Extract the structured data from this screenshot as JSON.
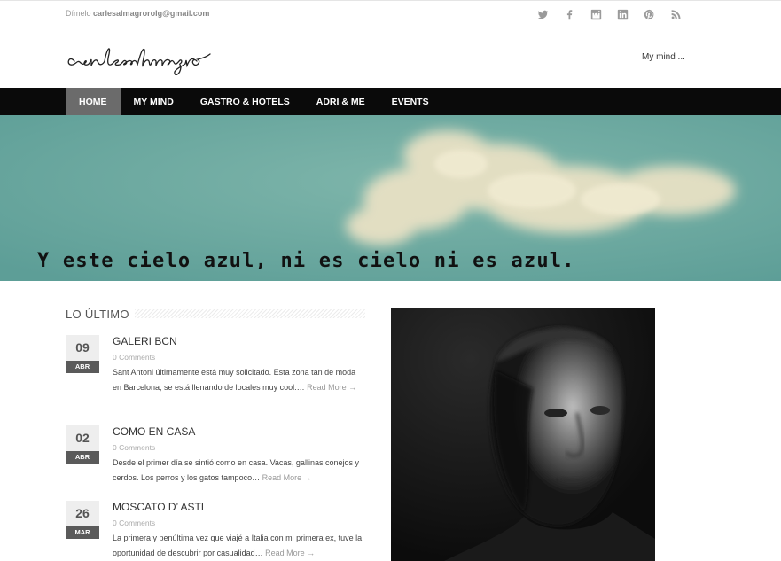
{
  "topbar": {
    "contact_prefix": "Dímelo",
    "contact_email": "carlesalmagrorolg@gmail.com",
    "social": [
      {
        "icon": "twitter-icon"
      },
      {
        "icon": "facebook-icon"
      },
      {
        "icon": "instagram-icon"
      },
      {
        "icon": "linkedin-icon"
      },
      {
        "icon": "pinterest-icon"
      },
      {
        "icon": "rss-icon"
      }
    ]
  },
  "header": {
    "logo_text": "carlesalmagro",
    "tagline": "My mind ..."
  },
  "nav": {
    "items": [
      "HOME",
      "MY MIND",
      "GASTRO & HOTELS",
      "ADRI & ME",
      "EVENTS"
    ],
    "active": "HOME"
  },
  "hero": {
    "quote": "Y este cielo azul, ni es cielo ni es azul."
  },
  "latest": {
    "title": "LO ÚLTIMO",
    "posts": [
      {
        "day": "09",
        "month": "ABR",
        "title": "GALERI BCN",
        "comments": "0 Comments",
        "excerpt": "Sant Antoni últimamente está muy solicitado. Esta zona tan de moda en Barcelona, se está llenando de locales muy cool.…",
        "more": "Read More →"
      },
      {
        "day": "02",
        "month": "ABR",
        "title": "COMO EN CASA",
        "comments": "0 Comments",
        "excerpt": "Desde el primer día se sintió como en casa. Vacas, gallinas conejos y cerdos. Los perros y los gatos tampoco…",
        "more": "Read More →"
      },
      {
        "day": "26",
        "month": "MAR",
        "title": "MOSCATO D’ ASTI",
        "comments": "0 Comments",
        "excerpt": "La primera y penúltima vez que viajé a Italia con mi primera ex, tuve la oportunidad de descubrir por casualidad…",
        "more": "Read More →"
      }
    ]
  },
  "colors": {
    "accent": "#c0272d",
    "nav_bg": "#0a0a0a",
    "nav_active": "#6b6b6b",
    "sky": "#6aa8a0"
  }
}
